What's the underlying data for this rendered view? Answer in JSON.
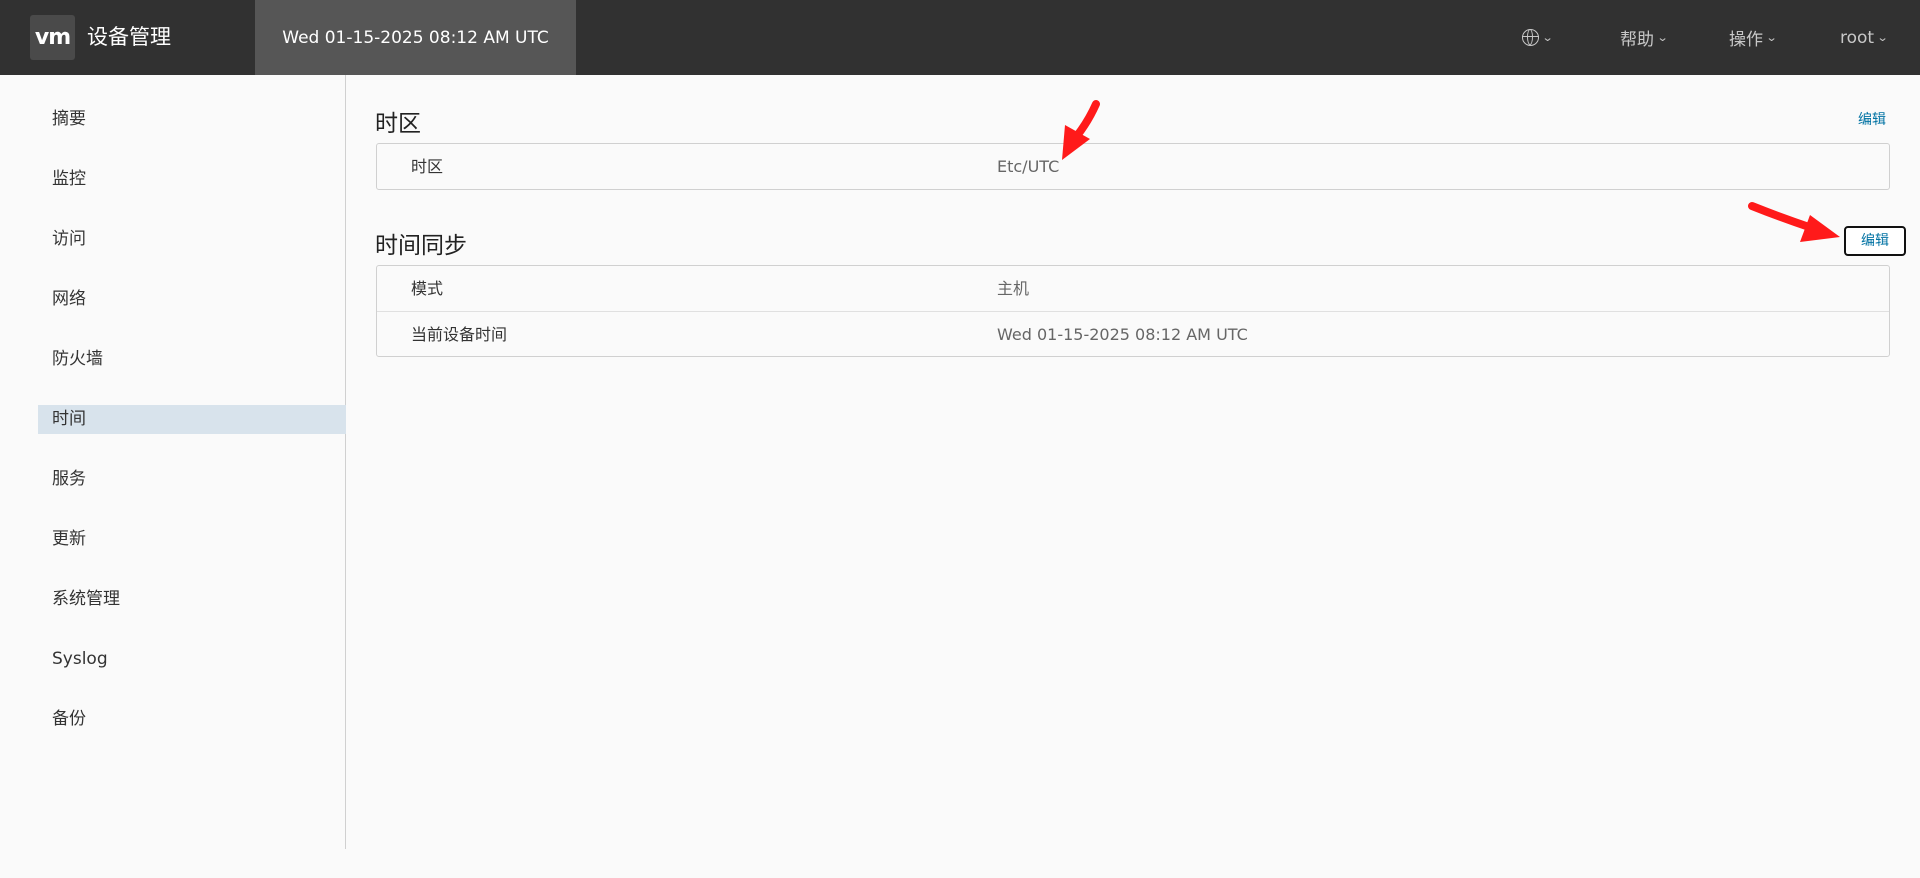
{
  "header": {
    "logo_text": "vm",
    "app_title": "设备管理",
    "datetime": "Wed 01-15-2025 08:12 AM UTC",
    "language_icon": "globe-icon",
    "menus": {
      "help": "帮助",
      "actions": "操作",
      "user": "root"
    }
  },
  "sidebar": {
    "items": [
      {
        "label": "摘要"
      },
      {
        "label": "监控"
      },
      {
        "label": "访问"
      },
      {
        "label": "网络"
      },
      {
        "label": "防火墙"
      },
      {
        "label": "时间",
        "active": true
      },
      {
        "label": "服务"
      },
      {
        "label": "更新"
      },
      {
        "label": "系统管理"
      },
      {
        "label": "Syslog"
      },
      {
        "label": "备份"
      }
    ]
  },
  "main": {
    "timezone": {
      "title": "时区",
      "edit_label": "编辑",
      "rows": [
        {
          "label": "时区",
          "value": "Etc/UTC"
        }
      ]
    },
    "time_sync": {
      "title": "时间同步",
      "edit_label": "编辑",
      "rows": [
        {
          "label": "模式",
          "value": "主机"
        },
        {
          "label": "当前设备时间",
          "value": "Wed 01-15-2025 08:12 AM UTC"
        }
      ]
    }
  },
  "colors": {
    "header_bg": "#313131",
    "active_tab_bg": "#565656",
    "active_nav_bg": "#d8e3ec",
    "link": "#0072a3",
    "annotation_arrow": "#ff1a1a"
  }
}
